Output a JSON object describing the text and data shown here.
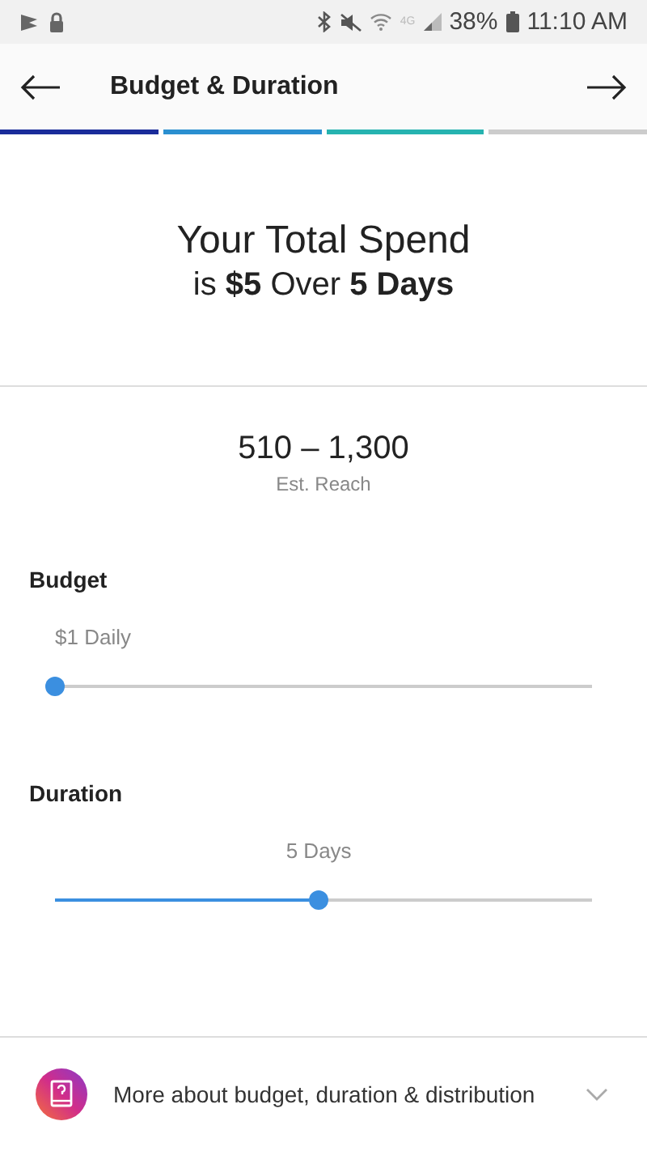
{
  "status_bar": {
    "network": "4G",
    "battery": "38%",
    "time": "11:10 AM"
  },
  "header": {
    "title": "Budget & Duration"
  },
  "progress": [
    {
      "color": "#1a2c9a"
    },
    {
      "color": "#2a8fd0"
    },
    {
      "color": "#26b3b0"
    },
    {
      "color": "#cccccc"
    }
  ],
  "summary": {
    "line_1": "Your Total Spend",
    "line_2": "is **$5** Over **5 Days**"
  },
  "reach": {
    "value": "510 – 1,300",
    "label": "Est. Reach"
  },
  "sliders": [
    {
      "title": "Budget",
      "reading": "$1 Daily",
      "level": 0
    },
    {
      "title": "Duration",
      "reading": "5 Days",
      "level": 0.49
    }
  ],
  "footer": {
    "text": "More about budget, duration & distribution",
    "expanded": false
  }
}
